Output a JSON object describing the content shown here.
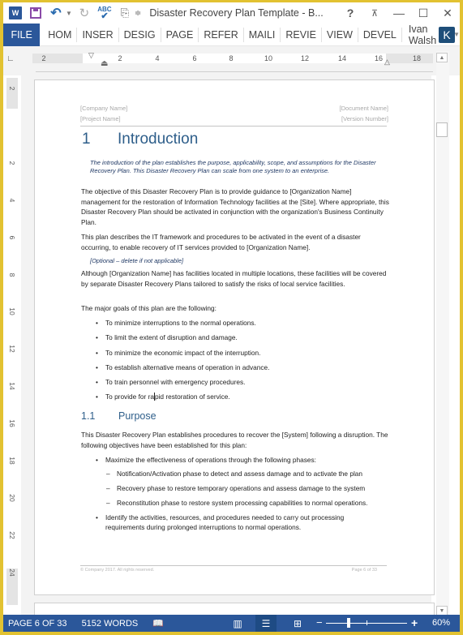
{
  "window": {
    "title": "Disaster Recovery Plan Template - B...",
    "app_icon": "word-icon",
    "quick_access": [
      "save-icon",
      "undo-icon",
      "redo-icon",
      "spelling-check-icon",
      "touch-mode-icon",
      "customize-toolbar-icon"
    ],
    "controls": {
      "help": "?",
      "ribbon_display": "⊼",
      "minimize": "—",
      "maximize": "☐",
      "close": "✕"
    }
  },
  "ribbon": {
    "file_tab": "FILE",
    "tabs": [
      "HOM",
      "INSER",
      "DESIG",
      "PAGE",
      "REFER",
      "MAILI",
      "REVIE",
      "VIEW",
      "DEVEL"
    ],
    "user_name": "Ivan Walsh",
    "avatar_letter": "K"
  },
  "ruler": {
    "horizontal_ticks": [
      "2",
      "2",
      "4",
      "6",
      "8",
      "10",
      "12",
      "14",
      "16",
      "18"
    ],
    "vertical_ticks": [
      "2",
      "2",
      "4",
      "6",
      "8",
      "10",
      "12",
      "14",
      "16",
      "18",
      "20",
      "22",
      "24"
    ]
  },
  "document": {
    "header": {
      "company": "[Company Name]",
      "document": "[Document Name]",
      "project": "[Project Name]",
      "version": "[Version Number]"
    },
    "heading1": {
      "number": "1",
      "text": "Introduction"
    },
    "intro_note": "The introduction of the plan establishes the purpose, applicability, scope, and assumptions for the Disaster Recovery Plan. This Disaster Recovery Plan can scale from one system to an enterprise.",
    "paragraphs": [
      "The objective of this Disaster Recovery Plan is to provide guidance to [Organization Name] management for the restoration of Information Technology facilities at the [Site]. Where appropriate, this Disaster Recovery Plan should be activated in conjunction with the organization's Business Continuity Plan.",
      "This plan describes the IT framework and procedures to be activated in the event of a disaster occurring, to enable recovery of IT services provided to [Organization Name].",
      "Although [Organization Name] has facilities located in multiple locations, these facilities will be covered by separate Disaster Recovery Plans tailored to satisfy the risks of local service facilities.",
      "The major goals of this plan are the following:"
    ],
    "optional_note": "[Optional – delete if not applicable]",
    "goals": [
      "To minimize interruptions to the normal operations.",
      "To limit the extent of disruption and damage.",
      "To minimize the economic impact of the interruption.",
      "To establish alternative means of operation in advance.",
      "To train personnel with emergency procedures.",
      "To provide for rapid restoration of service."
    ],
    "heading2": {
      "number": "1.1",
      "text": "Purpose"
    },
    "purpose_paragraph": "This Disaster Recovery Plan establishes procedures to recover the [System] following a disruption. The following objectives have been established for this plan:",
    "objectives": [
      "Maximize the effectiveness of operations through the following phases:",
      "Identify the activities, resources, and procedures needed to carry out processing requirements during prolonged interruptions to normal operations."
    ],
    "phases": [
      "Notification/Activation phase to detect and assess damage and to activate the plan",
      "Recovery phase to restore temporary operations and assess damage to the system",
      "Reconstitution phase to restore system processing capabilities to normal operations."
    ],
    "footer": {
      "copyright": "© Company 2017. All rights reserved.",
      "page": "Page 6 of 33"
    }
  },
  "status_bar": {
    "page": "PAGE 6 OF 33",
    "words": "5152 WORDS",
    "proofing_icon": "proofing-errors-icon",
    "views": [
      "read-mode",
      "print-layout",
      "web-layout"
    ],
    "active_view": "print-layout",
    "zoom_level": "60%",
    "zoom_percent": 60
  },
  "colors": {
    "accent": "#2b579a",
    "heading": "#2e5e8a",
    "frame": "#e2c231"
  }
}
